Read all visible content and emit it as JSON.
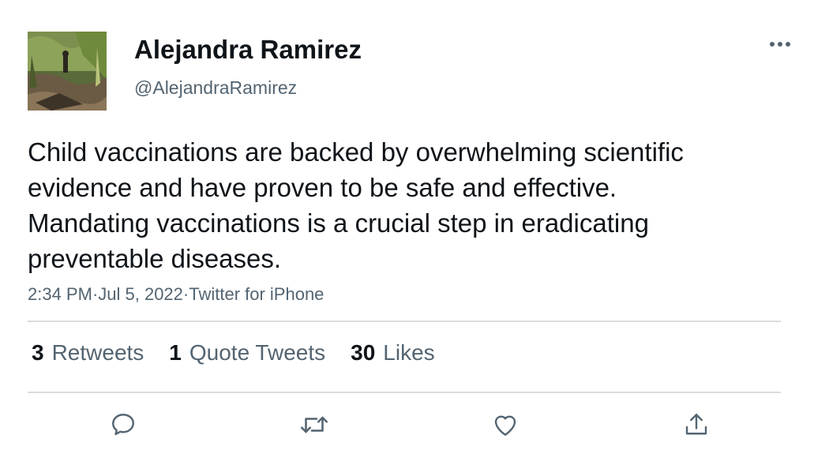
{
  "author": {
    "display_name": "Alejandra Ramirez",
    "handle": "@AlejandraRamirez"
  },
  "tweet": {
    "text": "Child vaccinations are backed by overwhelming scientific evidence and have proven to be safe and effective. Mandating vaccinations is a crucial step in eradicating preventable diseases.",
    "time": "2:34 PM",
    "date": "Jul 5, 2022",
    "source": "Twitter for iPhone",
    "separator": " · "
  },
  "stats": {
    "retweets_count": "3",
    "retweets_label": "Retweets",
    "quotes_count": "1",
    "quotes_label": "Quote Tweets",
    "likes_count": "30",
    "likes_label": "Likes"
  },
  "icons": {
    "more": "more-horizontal-icon",
    "reply": "reply-icon",
    "retweet": "retweet-icon",
    "like": "heart-icon",
    "share": "share-icon"
  },
  "colors": {
    "text_primary": "#0f1419",
    "text_secondary": "#536471",
    "divider": "#d8dcdf",
    "icon_gray": "#536471"
  }
}
